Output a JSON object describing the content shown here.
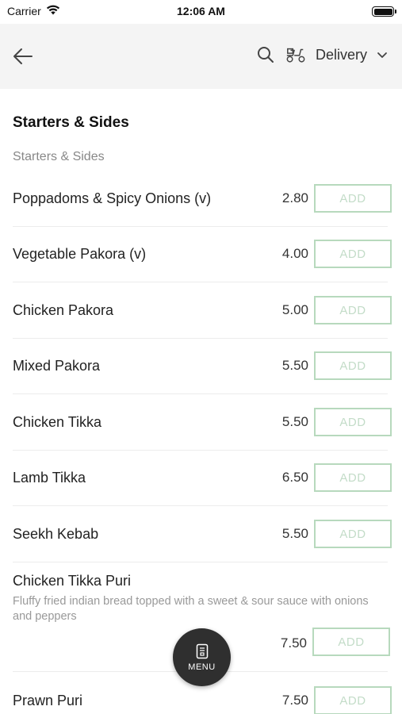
{
  "status_bar": {
    "carrier": "Carrier",
    "time": "12:06 AM"
  },
  "nav": {
    "delivery_label": "Delivery"
  },
  "section": {
    "title": "Starters & Sides",
    "subtitle": "Starters & Sides"
  },
  "items": [
    {
      "name": "Poppadoms & Spicy Onions (v)",
      "price": "2.80",
      "add": "ADD"
    },
    {
      "name": "Vegetable Pakora (v)",
      "price": "4.00",
      "add": "ADD"
    },
    {
      "name": "Chicken Pakora",
      "price": "5.00",
      "add": "ADD"
    },
    {
      "name": "Mixed Pakora",
      "price": "5.50",
      "add": "ADD"
    },
    {
      "name": "Chicken Tikka",
      "price": "5.50",
      "add": "ADD"
    },
    {
      "name": "Lamb Tikka",
      "price": "6.50",
      "add": "ADD"
    },
    {
      "name": "Seekh Kebab",
      "price": "5.50",
      "add": "ADD"
    }
  ],
  "puri": {
    "name": "Chicken Tikka Puri",
    "description": "Fluffy fried indian bread topped with a sweet & sour sauce with onions and peppers",
    "price": "7.50",
    "add": "ADD"
  },
  "prawn": {
    "name": "Prawn Puri",
    "price": "7.50",
    "add": "ADD"
  },
  "fab": {
    "label": "MENU"
  },
  "colors": {
    "add_border": "#b7d9bd",
    "nav_bg": "#f4f4f4",
    "fab_bg": "#2f2f2f"
  }
}
